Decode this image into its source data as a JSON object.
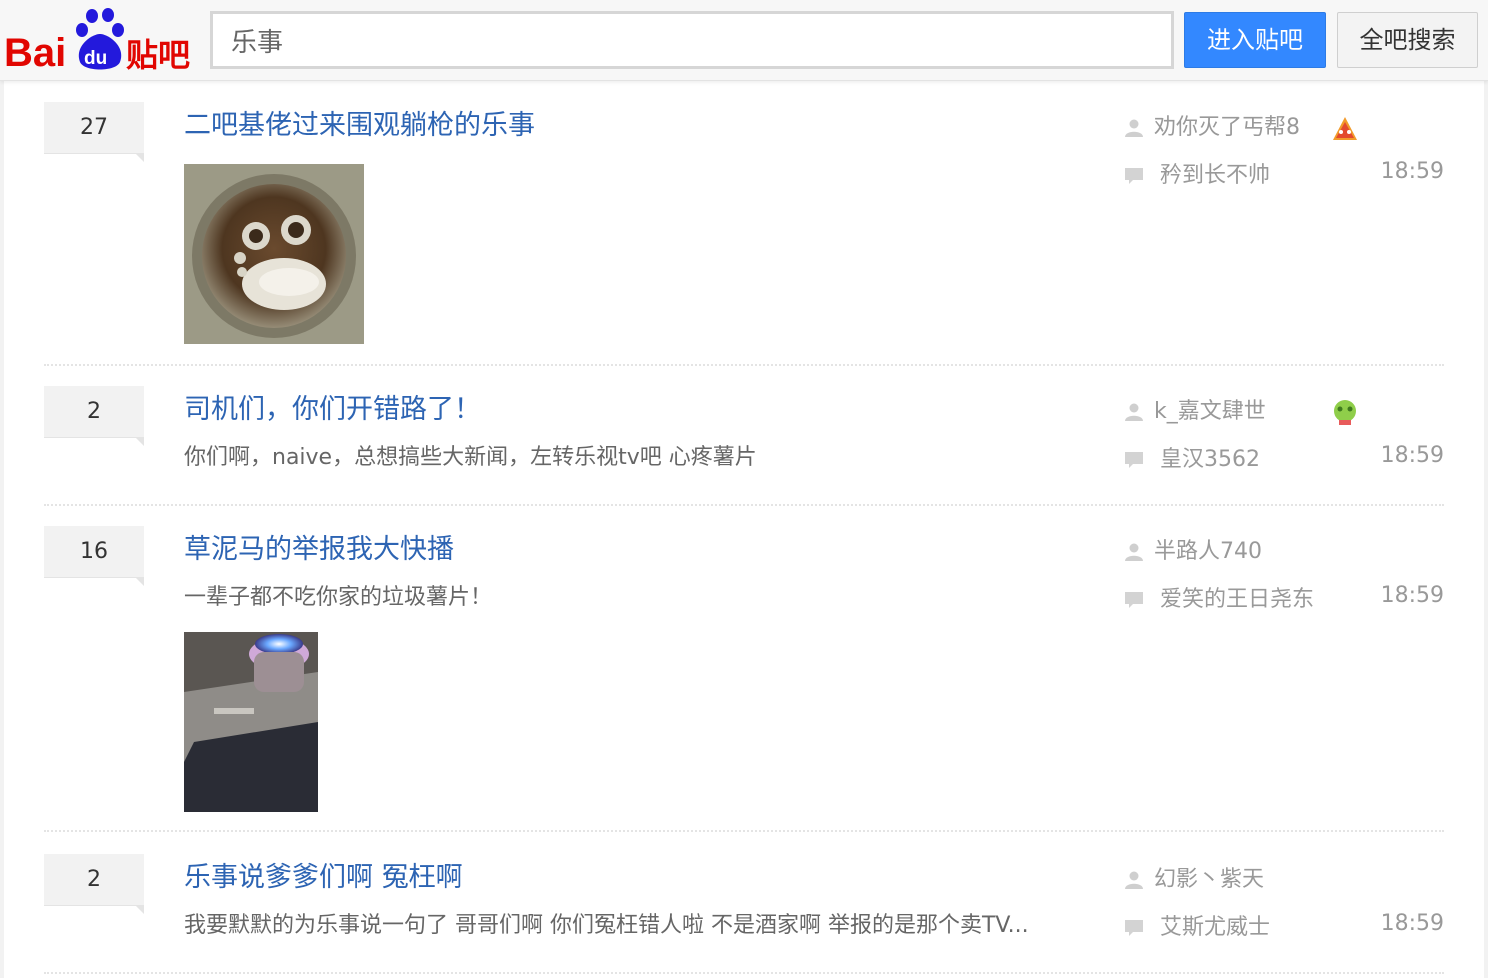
{
  "header": {
    "logo_text": "Bai du 贴吧",
    "search_value": "乐事",
    "enter_label": "进入贴吧",
    "search_all_label": "全吧搜索",
    "brand_red": "#e10601",
    "brand_blue": "#2319dc",
    "accent": "#3388ff"
  },
  "posts": [
    {
      "replies": "27",
      "title": "二吧基佬过来围观躺枪的乐事",
      "abstract": "",
      "author": "劝你灭了丐帮8",
      "author_badge_icon": "red-level-badge-icon",
      "last_reply_user": "矜到长不帅",
      "time": "18:59",
      "thumbnail": "frog-in-bowl-photo"
    },
    {
      "replies": "2",
      "title": "司机们，你们开错路了！",
      "abstract": "你们啊，naive，总想搞些大新闻，左转乐视tv吧 心疼薯片",
      "author": "k_嘉文肆世",
      "author_badge_icon": "green-level-badge-icon",
      "last_reply_user": "皇汉3562",
      "time": "18:59",
      "thumbnail": ""
    },
    {
      "replies": "16",
      "title": "草泥马的举报我大快播",
      "abstract": "一辈子都不吃你家的垃圾薯片！",
      "author": "半路人740",
      "author_badge_icon": "",
      "last_reply_user": "爱笑的王日尧东",
      "time": "18:59",
      "thumbnail": "glowing-device-photo"
    },
    {
      "replies": "2",
      "title": "乐事说爹爹们啊 冤枉啊",
      "abstract": "我要默默的为乐事说一句了 哥哥们啊 你们冤枉错人啦 不是酒家啊 举报的是那个卖TV...",
      "author": "幻影丶紫天",
      "author_badge_icon": "",
      "last_reply_user": "艾斯尤威士",
      "time": "18:59",
      "thumbnail": ""
    }
  ]
}
